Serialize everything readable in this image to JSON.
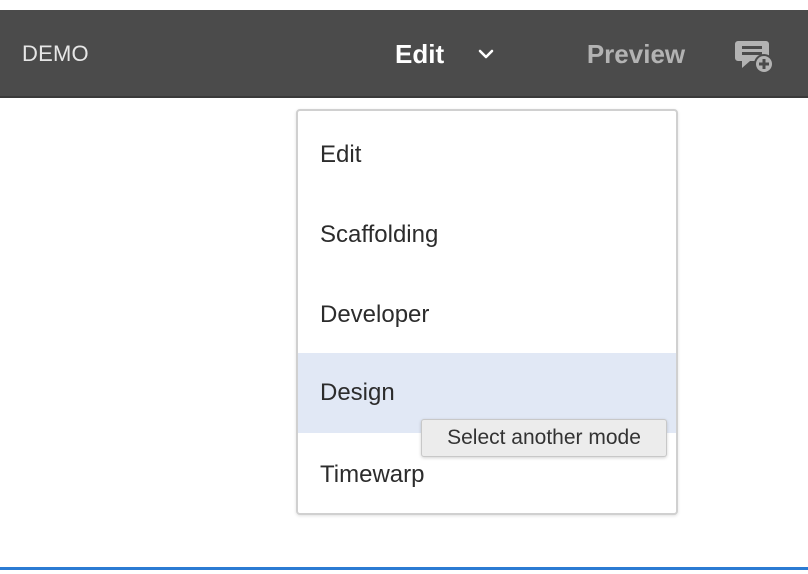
{
  "toolbar": {
    "app_title": "DEMO",
    "mode_label": "Edit",
    "mode_chevron_icon": "chevron-down-icon",
    "preview_label": "Preview",
    "annotate_icon": "add-annotation-icon",
    "background_color": "#4b4b4b"
  },
  "mode_menu": {
    "items": [
      {
        "label": "Edit",
        "hovered": false
      },
      {
        "label": "Scaffolding",
        "hovered": false
      },
      {
        "label": "Developer",
        "hovered": false
      },
      {
        "label": "Design",
        "hovered": true
      },
      {
        "label": "Timewarp",
        "hovered": false
      }
    ],
    "hover_color": "#e1e8f5"
  },
  "tooltip": {
    "text": "Select another mode"
  },
  "page_frame": {
    "accent_color": "#2b7bd3"
  }
}
